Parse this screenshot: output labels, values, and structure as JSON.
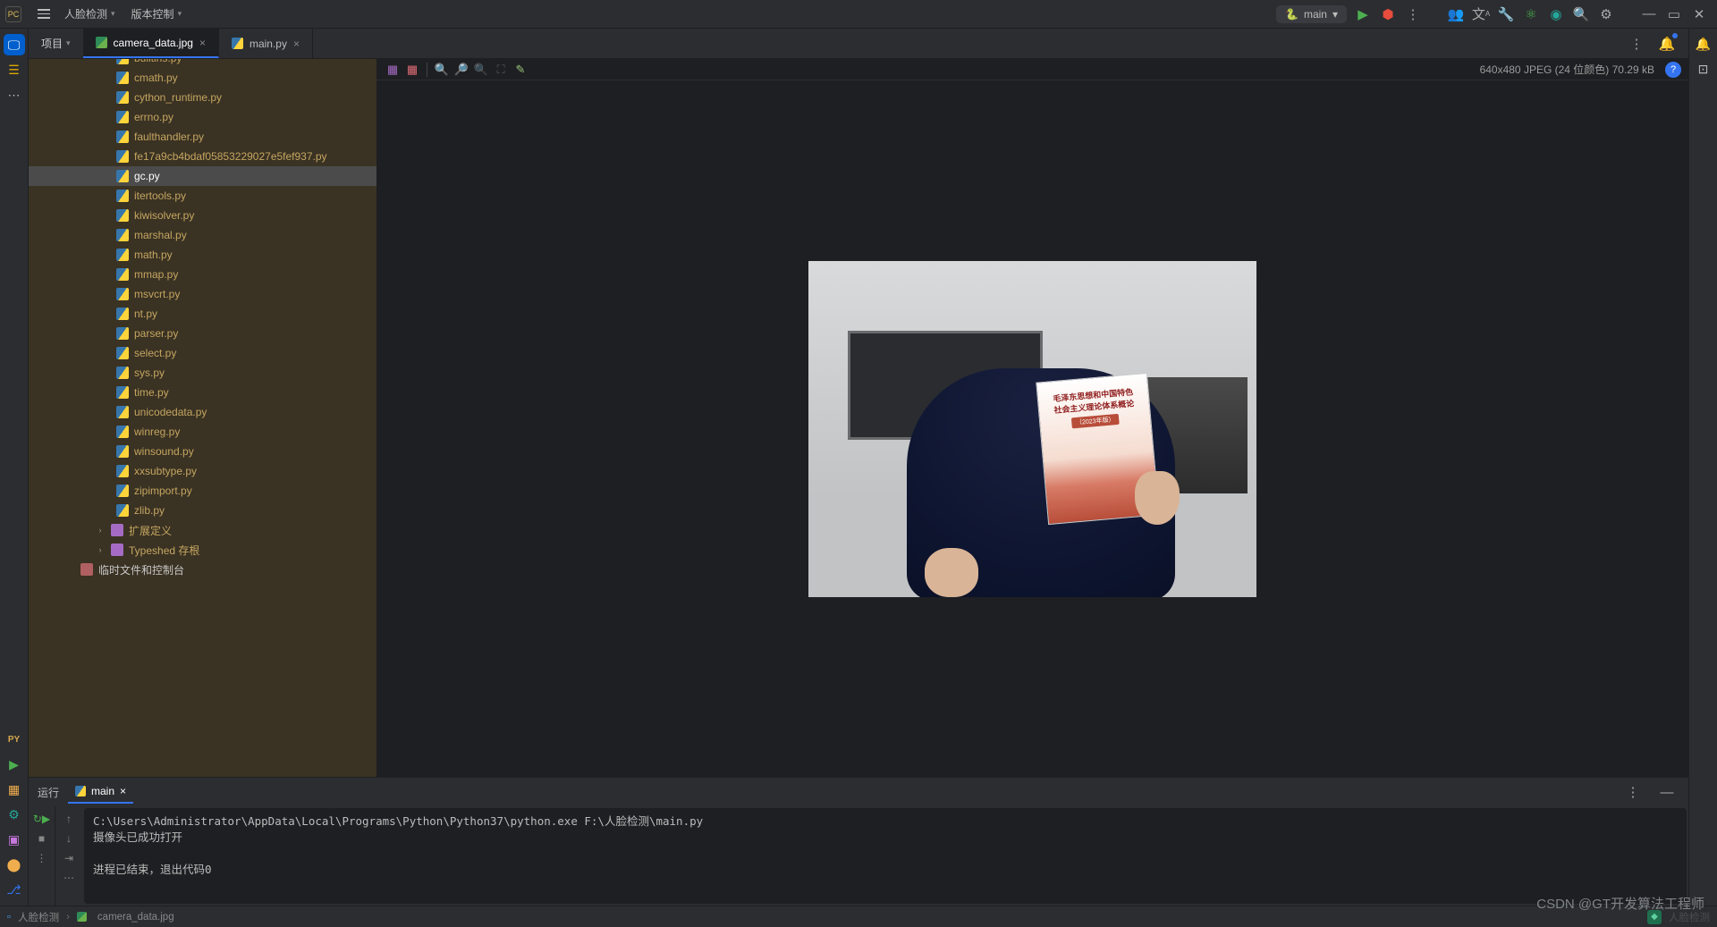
{
  "menubar": {
    "items": [
      "人脸检测",
      "版本控制"
    ],
    "run_config": "main"
  },
  "project_header": "项目",
  "tabs": [
    {
      "label": "camera_data.jpg",
      "kind": "img",
      "active": true
    },
    {
      "label": "main.py",
      "kind": "py",
      "active": false
    }
  ],
  "image_info": "640x480 JPEG (24 位颜色) 70.29 kB",
  "tree": {
    "indent": 98,
    "files": [
      "builtins.py",
      "cmath.py",
      "cython_runtime.py",
      "errno.py",
      "faulthandler.py",
      "fe17a9cb4bdaf05853229027e5fef937.py",
      "gc.py",
      "itertools.py",
      "kiwisolver.py",
      "marshal.py",
      "math.py",
      "mmap.py",
      "msvcrt.py",
      "nt.py",
      "parser.py",
      "select.py",
      "sys.py",
      "time.py",
      "unicodedata.py",
      "winreg.py",
      "winsound.py",
      "xxsubtype.py",
      "zipimport.py",
      "zlib.py"
    ],
    "selected": "gc.py",
    "libs": [
      "扩展定义",
      "Typeshed 存根"
    ],
    "lib_indent": 74,
    "scratch": "临时文件和控制台",
    "scratch_indent": 58
  },
  "book": {
    "line1": "毛泽东思想和中国特色",
    "line2": "社会主义理论体系概论",
    "edition": "（2023年版）"
  },
  "run_panel": {
    "title": "运行",
    "tab": "main",
    "lines": [
      "C:\\Users\\Administrator\\AppData\\Local\\Programs\\Python\\Python37\\python.exe  F:\\人脸检测\\main.py",
      "摄像头已成功打开",
      "",
      "进程已结束，退出代码0"
    ]
  },
  "status": {
    "crumb1": "人脸检测",
    "crumb2": "camera_data.jpg",
    "right": "人脸检测"
  },
  "watermark": "CSDN @GT开发算法工程师"
}
